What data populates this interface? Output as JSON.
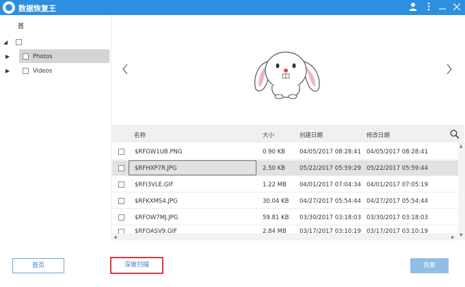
{
  "titlebar": {
    "title": "数据恢复王",
    "icons": [
      "user-icon",
      "more-vert-icon",
      "minimize-icon",
      "close-icon"
    ]
  },
  "sidebar": {
    "header_label": "首",
    "tree": [
      {
        "label": "Photos",
        "selected": true
      },
      {
        "label": "Videos",
        "selected": false
      }
    ]
  },
  "preview": {
    "prev_icon": "chevron-left-icon",
    "next_icon": "chevron-right-icon",
    "image": "bunny-mascot"
  },
  "table": {
    "columns": [
      "名称",
      "大小",
      "创建日期",
      "修改日期"
    ],
    "search_icon": "search-icon",
    "rows": [
      {
        "name": "$RFGW1UB.PNG",
        "size": "0.90 KB",
        "created": "04/05/2017 08:28:41",
        "modified": "04/05/2017 08:28:41"
      },
      {
        "name": "$RFHXP7R.JPG",
        "size": "2.50 KB",
        "created": "05/22/2017 05:59:29",
        "modified": "05/22/2017 05:59:44"
      },
      {
        "name": "$RFI3VLE.GIF",
        "size": "1.22 MB",
        "created": "04/01/2017 07:04:34",
        "modified": "04/01/2017 07:05:19"
      },
      {
        "name": "$RFKXMS4.JPG",
        "size": "30.04 KB",
        "created": "04/27/2017 05:54:44",
        "modified": "04/27/2017 05:54:44"
      },
      {
        "name": "$RFOW7MJ.JPG",
        "size": "59.81 KB",
        "created": "03/30/2017 03:18:03",
        "modified": "03/30/2017 03:18:03"
      },
      {
        "name": "$RFOASV9.GIF",
        "size": "2.84 MB",
        "created": "03/17/2017 03:10:19",
        "modified": "03/17/2017 03:10:19"
      }
    ]
  },
  "footer": {
    "home_label": "首页",
    "deep_scan_label": "深度扫描",
    "recover_label": "恢复"
  },
  "colors": {
    "accent": "#2d8fdf",
    "highlight_border": "#d9383a",
    "recover_button": "#8fbde6"
  }
}
